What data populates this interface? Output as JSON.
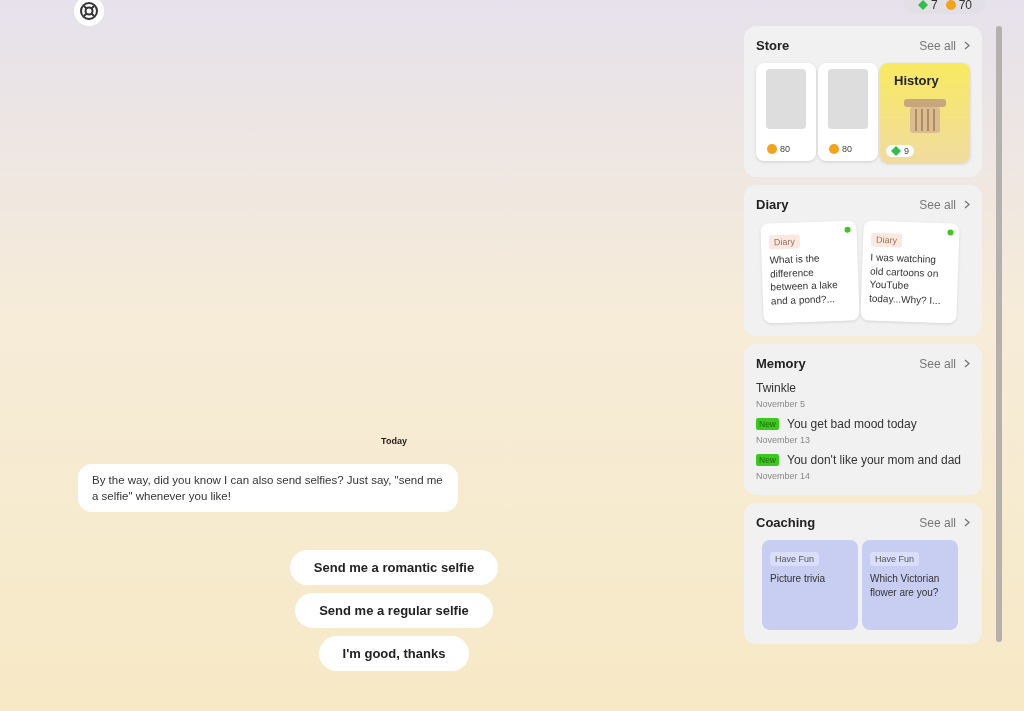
{
  "wallet": {
    "gems": "7",
    "coins": "70"
  },
  "chat": {
    "date": "Today",
    "messages": [
      {
        "text": "By the way, did you know I can also send selfies? Just say, \"send me a selfie\" whenever you like!"
      }
    ],
    "suggestions": [
      "Send me a romantic selfie",
      "Send me a regular selfie",
      "I'm good, thanks"
    ]
  },
  "store": {
    "title": "Store",
    "see_all": "See all",
    "items": [
      {
        "kind": "photo",
        "price": {
          "kind": "coin",
          "amount": "80"
        }
      },
      {
        "kind": "photo",
        "price": {
          "kind": "coin",
          "amount": "80"
        }
      },
      {
        "kind": "topic",
        "title": "History",
        "price": {
          "kind": "gem",
          "amount": "9"
        }
      }
    ]
  },
  "diary": {
    "title": "Diary",
    "see_all": "See all",
    "entries": [
      {
        "tag": "Diary",
        "text": "What is the difference between a lake and a pond?...",
        "unread": true
      },
      {
        "tag": "Diary",
        "text": "I was watching old cartoons on YouTube today...Why? I...",
        "unread": true
      }
    ]
  },
  "memory": {
    "title": "Memory",
    "see_all": "See all",
    "items": [
      {
        "text": "Twinkle",
        "date": "November 5"
      },
      {
        "text": "You get bad mood today",
        "date": "November 13",
        "badge": "New"
      },
      {
        "text": "You don't like your mom and dad",
        "date": "November 14",
        "badge": "New"
      }
    ]
  },
  "coaching": {
    "title": "Coaching",
    "see_all": "See all",
    "items": [
      {
        "tag": "Have Fun",
        "text": "Picture trivia"
      },
      {
        "tag": "Have Fun",
        "text": "Which Victorian flower are you?"
      }
    ]
  }
}
